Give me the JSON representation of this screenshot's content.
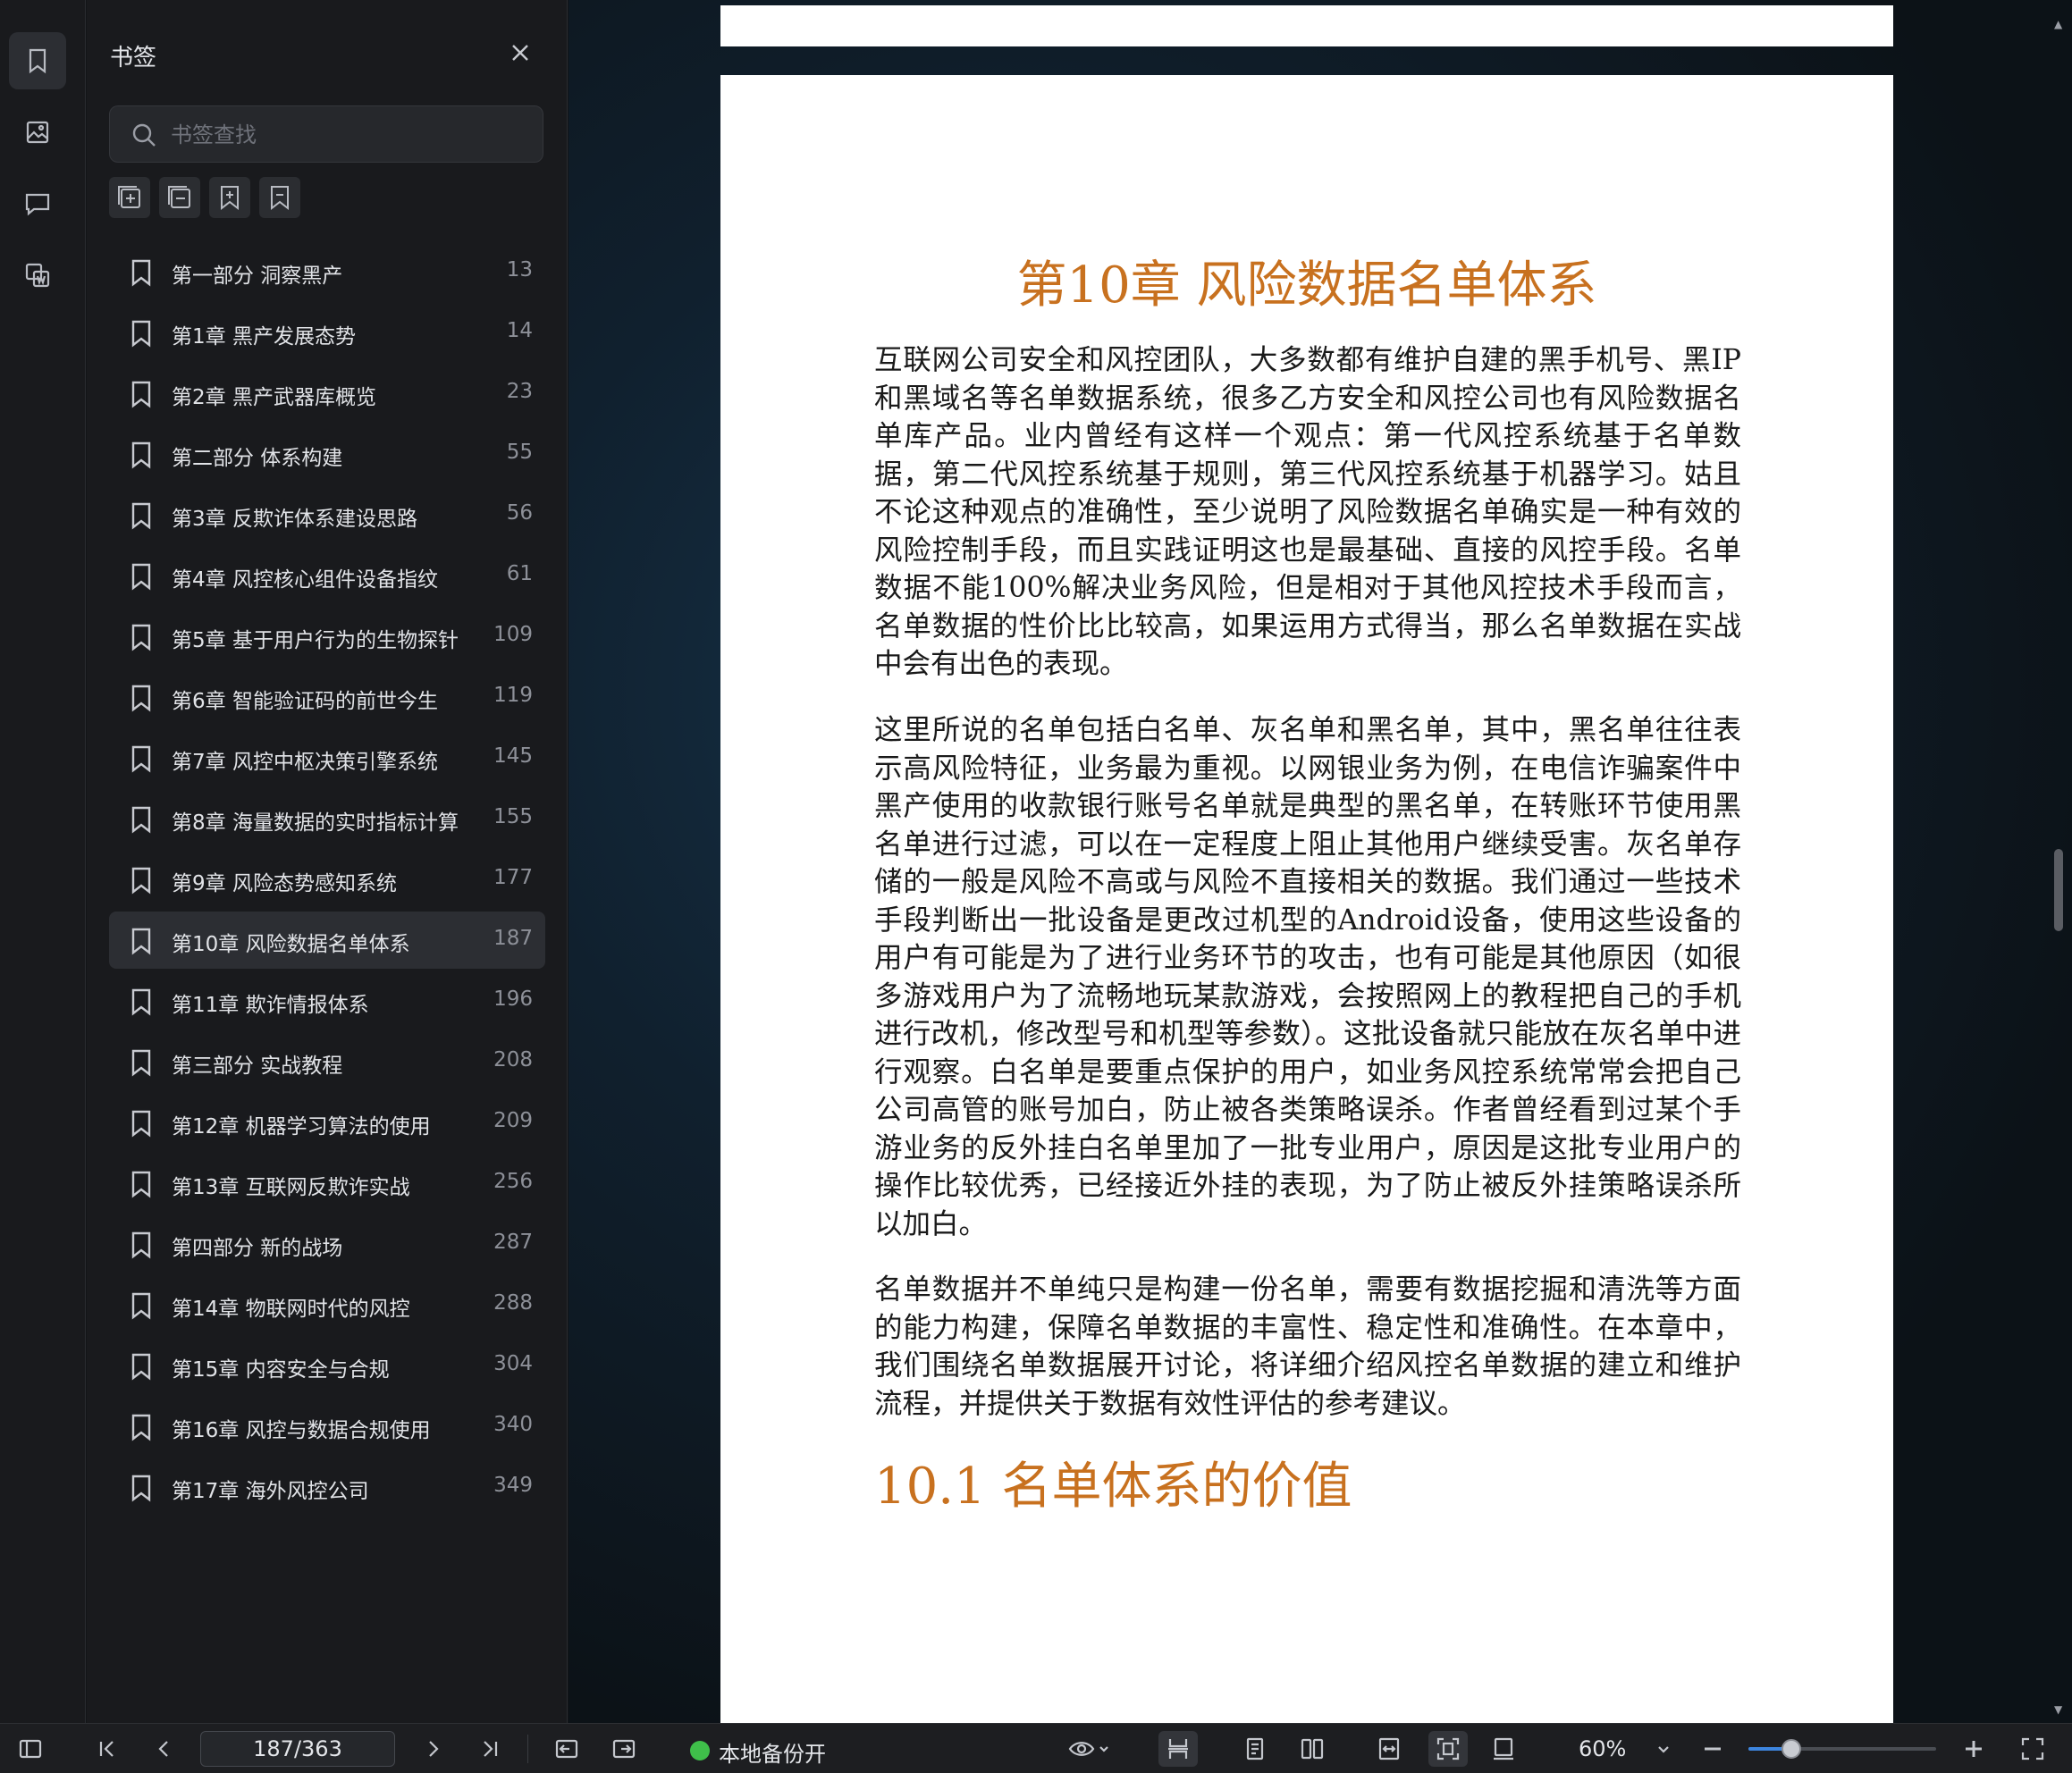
{
  "panel": {
    "title": "书签",
    "search_placeholder": "书签查找",
    "bookmarks": [
      {
        "label": "第一部分 洞察黑产",
        "page": "13"
      },
      {
        "label": "第1章 黑产发展态势",
        "page": "14"
      },
      {
        "label": "第2章 黑产武器库概览",
        "page": "23"
      },
      {
        "label": "第二部分 体系构建",
        "page": "55"
      },
      {
        "label": "第3章 反欺诈体系建设思路",
        "page": "56"
      },
      {
        "label": "第4章 风控核心组件设备指纹",
        "page": "61"
      },
      {
        "label": "第5章 基于用户行为的生物探针",
        "page": "109"
      },
      {
        "label": "第6章 智能验证码的前世今生",
        "page": "119"
      },
      {
        "label": "第7章 风控中枢决策引擎系统",
        "page": "145"
      },
      {
        "label": "第8章 海量数据的实时指标计算",
        "page": "155"
      },
      {
        "label": "第9章 风险态势感知系统",
        "page": "177"
      },
      {
        "label": "第10章 风险数据名单体系",
        "page": "187",
        "selected": true
      },
      {
        "label": "第11章 欺诈情报体系",
        "page": "196"
      },
      {
        "label": "第三部分 实战教程",
        "page": "208"
      },
      {
        "label": "第12章 机器学习算法的使用",
        "page": "209"
      },
      {
        "label": "第13章 互联网反欺诈实战",
        "page": "256"
      },
      {
        "label": "第四部分 新的战场",
        "page": "287"
      },
      {
        "label": "第14章 物联网时代的风控",
        "page": "288"
      },
      {
        "label": "第15章 内容安全与合规",
        "page": "304"
      },
      {
        "label": "第16章 风控与数据合规使用",
        "page": "340"
      },
      {
        "label": "第17章 海外风控公司",
        "page": "349"
      }
    ]
  },
  "document": {
    "chapter_title": "第10章 风险数据名单体系",
    "para1": "互联网公司安全和风控团队，大多数都有维护自建的黑手机号、黑IP和黑域名等名单数据系统，很多乙方安全和风控公司也有风险数据名单库产品。业内曾经有这样一个观点：第一代风控系统基于名单数据，第二代风控系统基于规则，第三代风控系统基于机器学习。姑且不论这种观点的准确性，至少说明了风险数据名单确实是一种有效的风险控制手段，而且实践证明这也是最基础、直接的风控手段。名单数据不能100%解决业务风险，但是相对于其他风控技术手段而言，名单数据的性价比比较高，如果运用方式得当，那么名单数据在实战中会有出色的表现。",
    "para2": "这里所说的名单包括白名单、灰名单和黑名单，其中，黑名单往往表示高风险特征，业务最为重视。以网银业务为例，在电信诈骗案件中黑产使用的收款银行账号名单就是典型的黑名单，在转账环节使用黑名单进行过滤，可以在一定程度上阻止其他用户继续受害。灰名单存储的一般是风险不高或与风险不直接相关的数据。我们通过一些技术手段判断出一批设备是更改过机型的Android设备，使用这些设备的用户有可能是为了进行业务环节的攻击，也有可能是其他原因（如很多游戏用户为了流畅地玩某款游戏，会按照网上的教程把自己的手机进行改机，修改型号和机型等参数）。这批设备就只能放在灰名单中进行观察。白名单是要重点保护的用户，如业务风控系统常常会把自己公司高管的账号加白，防止被各类策略误杀。作者曾经看到过某个手游业务的反外挂白名单里加了一批专业用户，原因是这批专业用户的操作比较优秀，已经接近外挂的表现，为了防止被反外挂策略误杀所以加白。",
    "para3": "名单数据并不单纯只是构建一份名单，需要有数据挖掘和清洗等方面的能力构建，保障名单数据的丰富性、稳定性和准确性。在本章中，我们围绕名单数据展开讨论，将详细介绍风控名单数据的建立和维护流程，并提供关于数据有效性评估的参考建议。",
    "section_title": "10.1 名单体系的价值"
  },
  "bottombar": {
    "page_indicator": "187/363",
    "backup_status": "本地备份开",
    "backup_color": "#3fbf4a",
    "zoom_level": "60%",
    "zoom_fraction": 0.23
  },
  "icons": {
    "rail": [
      "bookmark-icon",
      "image-icon",
      "comment-icon",
      "translate-icon"
    ],
    "tools": [
      "expand-all-icon",
      "collapse-all-icon",
      "add-bookmark-icon",
      "remove-bookmark-icon"
    ]
  },
  "colors": {
    "heading": "#c8711f",
    "accent": "#3d86e0"
  }
}
